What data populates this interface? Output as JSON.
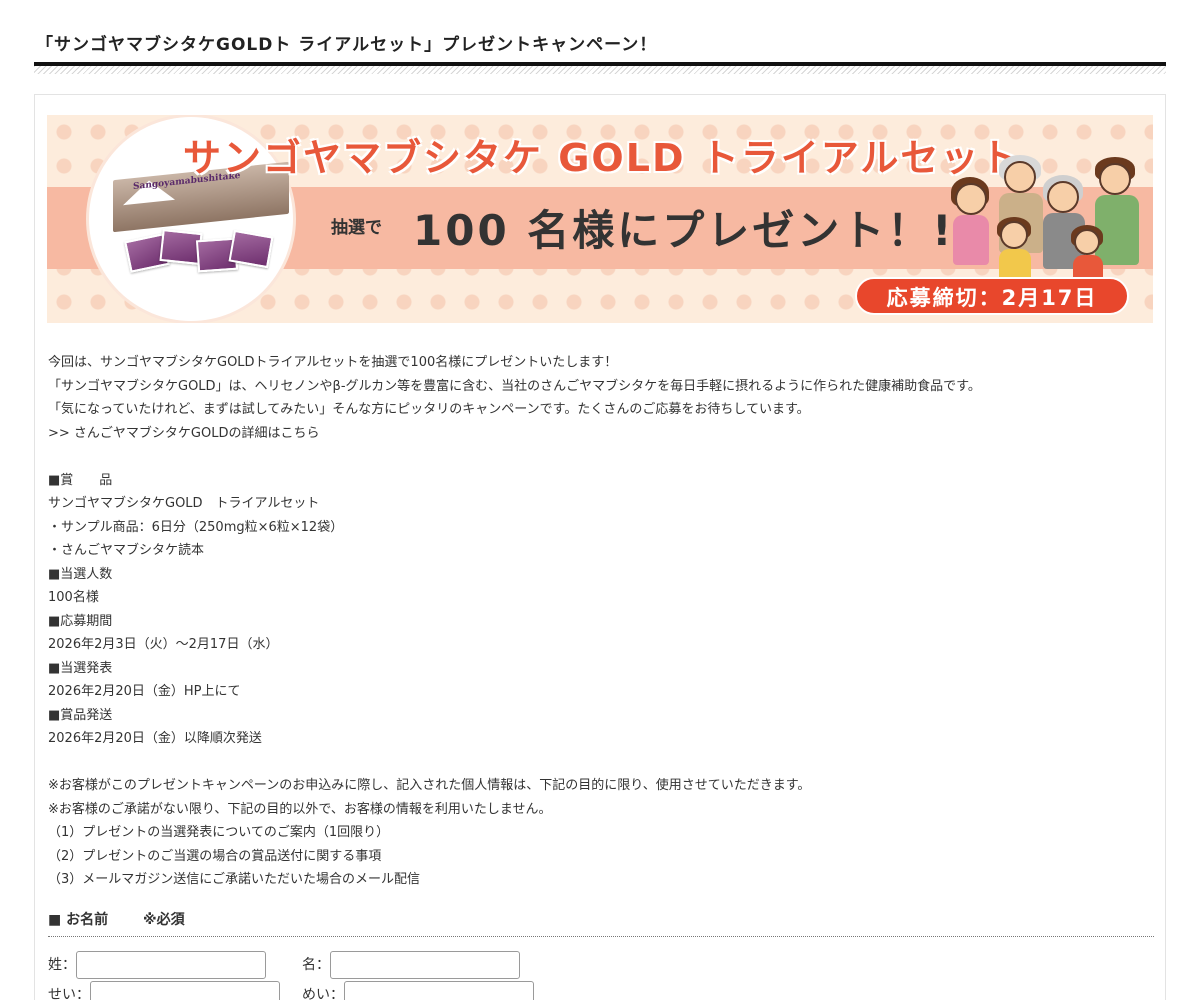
{
  "page": {
    "title": "「サンゴヤマブシタケGOLDト ライアルセット」プレゼントキャンペーン！"
  },
  "banner": {
    "title": "サンゴヤマブシタケ GOLD トライアルセット",
    "lottery": "抽選で",
    "present": "100 名様にプレゼント！!",
    "deadline": "応募締切：2月17日",
    "product_label": "Sangoyamabushitake"
  },
  "intro": [
    "今回は、サンゴヤマブシタケGOLDトライアルセットを抽選で100名様にプレゼントいたします！",
    "「サンゴヤマブシタケGOLD」は、ヘリセノンやβ-グルカン等を豊富に含む、当社のさんごヤマブシタケを毎日手軽に摂れるように作られた健康補助食品です。",
    "「気になっていたけれど、まずは試してみたい」そんな方にピッタリのキャンペーンです。たくさんのご応募をお待ちしています。"
  ],
  "detail_link": ">> さんごヤマブシタケGOLDの詳細はこちら",
  "details": [
    "■賞　　品",
    "サンゴヤマブシタケGOLD　トライアルセット",
    "・サンプル商品：6日分（250mg粒×6粒×12袋）",
    "・さんごヤマブシタケ読本",
    "■当選人数",
    "100名様",
    "■応募期間",
    "2026年2月3日（火）～2月17日（水）",
    "■当選発表",
    "2026年2月20日（金）HP上にて",
    "■賞品発送",
    "2026年2月20日（金）以降順次発送"
  ],
  "privacy": [
    "※お客様がこのプレゼントキャンペーンのお申込みに際し、記入された個人情報は、下記の目的に限り、使用させていただきます。",
    "※お客様のご承諾がない限り、下記の目的以外で、お客様の情報を利用いたしません。",
    "（1）プレゼントの当選発表についてのご案内（1回限り）",
    "（2）プレゼントのご当選の場合の賞品送付に関する事項",
    "（3）メールマガジン送信にご承諾いただいた場合のメール配信"
  ],
  "form": {
    "name_label": "■ お名前",
    "required": "※必須",
    "last_name_label": "姓：",
    "first_name_label": "名：",
    "last_kana_label": "せい：",
    "first_kana_label": "めい：",
    "last_name_value": "",
    "first_name_value": "",
    "last_kana_value": "",
    "first_kana_value": ""
  },
  "colors": {
    "accent": "#e8583a",
    "badge": "#e8472c",
    "heading_rule": "#111111"
  }
}
